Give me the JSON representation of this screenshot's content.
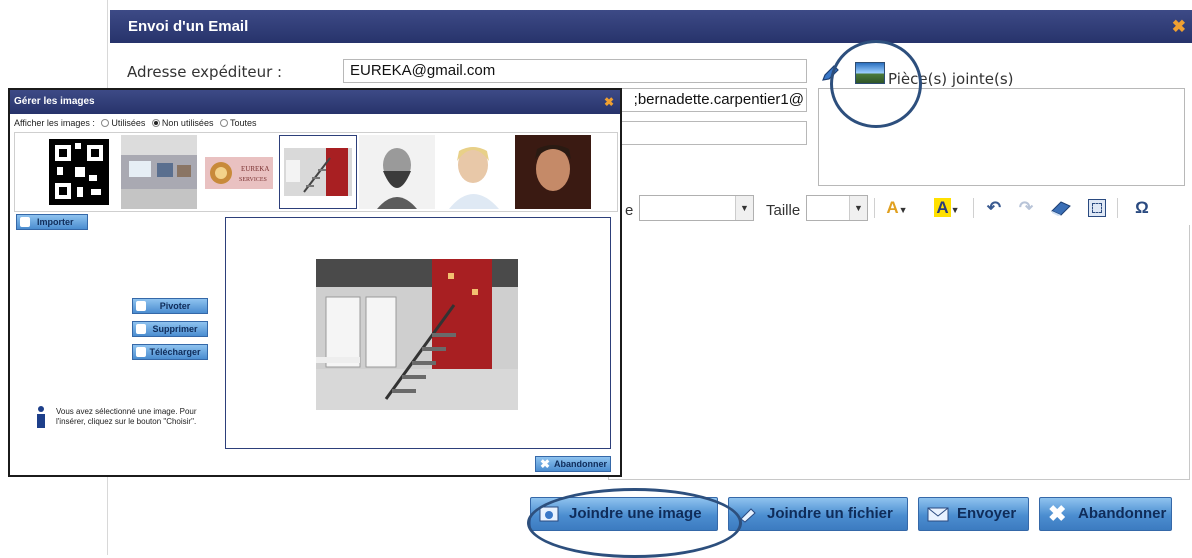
{
  "dialog": {
    "title": "Envoi d'un Email",
    "close_icon": "close-x-icon",
    "sender_label": "Adresse expéditeur :",
    "sender_value": "EUREKA@gmail.com",
    "recipient_value": ";bernadette.carpentier1@",
    "attachments_label": "Pièce(s) jointe(s)",
    "size_label": "Taille",
    "font_label_fragment": "e"
  },
  "toolbar": {
    "icons": [
      "text-color-icon",
      "highlight-color-icon",
      "undo-icon",
      "redo-icon",
      "eraser-icon",
      "select-all-icon",
      "special-char-icon"
    ],
    "text_color_glyph": "A",
    "highlight_glyph": "A",
    "undo_glyph": "↶",
    "redo_glyph": "↷",
    "omega_glyph": "Ω"
  },
  "buttons": {
    "insert_image": "Joindre une image",
    "attach_file": "Joindre un fichier",
    "send": "Envoyer",
    "cancel": "Abandonner"
  },
  "image_manager": {
    "title": "Gérer les images",
    "filter_label": "Afficher les images :",
    "filter_options": [
      "Utilisées",
      "Non utilisées",
      "Toutes"
    ],
    "filter_selected": "Non utilisées",
    "import_label": "Importer",
    "rotate_label": "Pivoter",
    "delete_label": "Supprimer",
    "download_label": "Télécharger",
    "info_text": "Vous avez sélectionné une image. Pour l'insérer, cliquez sur le bouton \"Choisir\".",
    "cancel_label": "Abandonner",
    "logo_text_1": "EUREKA",
    "logo_text_2": "SERVICES",
    "thumbnails": [
      "qr-code-image",
      "office-interior-image",
      "eureka-services-logo-image",
      "red-wall-staircase-image",
      "bearded-man-portrait-image",
      "smiling-woman-headset-image",
      "man-portrait-image"
    ]
  },
  "colors": {
    "title_bar": "#2f3b76",
    "button_blue": "#4b8dd0",
    "close_orange": "#f0a030",
    "annotation_circle": "#2d4f7d"
  }
}
